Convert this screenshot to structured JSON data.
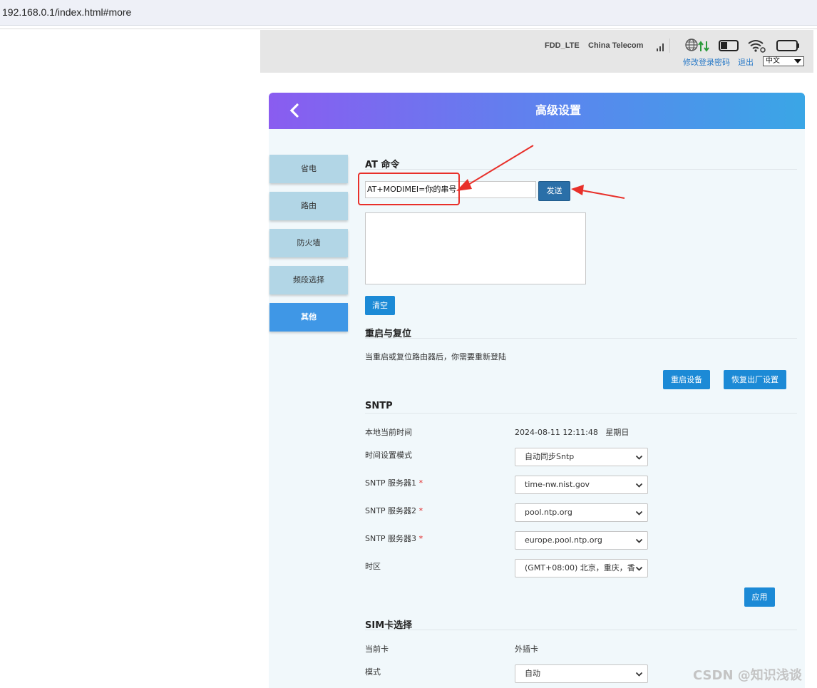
{
  "browser": {
    "url": "192.168.0.1/index.html#more"
  },
  "status": {
    "network_type": "FDD_LTE",
    "operator": "China Telecom",
    "change_password_link": "修改登录密码",
    "logout_link": "退出",
    "language": "中文",
    "icons": [
      "signal-icon",
      "globe-icon",
      "data-arrows-icon",
      "sim-icon",
      "wifi-icon",
      "battery-icon"
    ]
  },
  "header": {
    "title": "高级设置"
  },
  "sidebar": {
    "items": [
      {
        "label": "省电",
        "active": false
      },
      {
        "label": "路由",
        "active": false
      },
      {
        "label": "防火墙",
        "active": false
      },
      {
        "label": "频段选择",
        "active": false
      },
      {
        "label": "其他",
        "active": true
      }
    ]
  },
  "at": {
    "title": "AT 命令",
    "input_value": "AT+MODIMEI=你的串号",
    "send_label": "发送",
    "response": "",
    "clear_label": "清空"
  },
  "reboot": {
    "title": "重启与复位",
    "note": "当重启或复位路由器后，你需要重新登陆",
    "restart_label": "重启设备",
    "factory_label": "恢复出厂设置"
  },
  "sntp": {
    "title": "SNTP",
    "local_time_label": "本地当前时间",
    "local_time_value": "2024-08-11 12:11:48   星期日",
    "mode_label": "时间设置模式",
    "mode_value": "自动同步Sntp",
    "server1_label": "SNTP 服务器1",
    "server1_value": "time-nw.nist.gov",
    "server2_label": "SNTP 服务器2",
    "server2_value": "pool.ntp.org",
    "server3_label": "SNTP 服务器3",
    "server3_value": "europe.pool.ntp.org",
    "required_mark": "*",
    "tz_label": "时区",
    "tz_value": "(GMT+08:00) 北京，重庆，香",
    "apply_label": "应用"
  },
  "sim": {
    "title": "SIM卡选择",
    "current_label": "当前卡",
    "current_value": "外插卡",
    "mode_label": "模式",
    "mode_value": "自动"
  },
  "watermark": "CSDN @知识浅谈",
  "colors": {
    "accent": "#1c8ad6",
    "annotation": "#e8302a",
    "header_start": "#8a5cf0",
    "header_end": "#3aa6e6"
  }
}
